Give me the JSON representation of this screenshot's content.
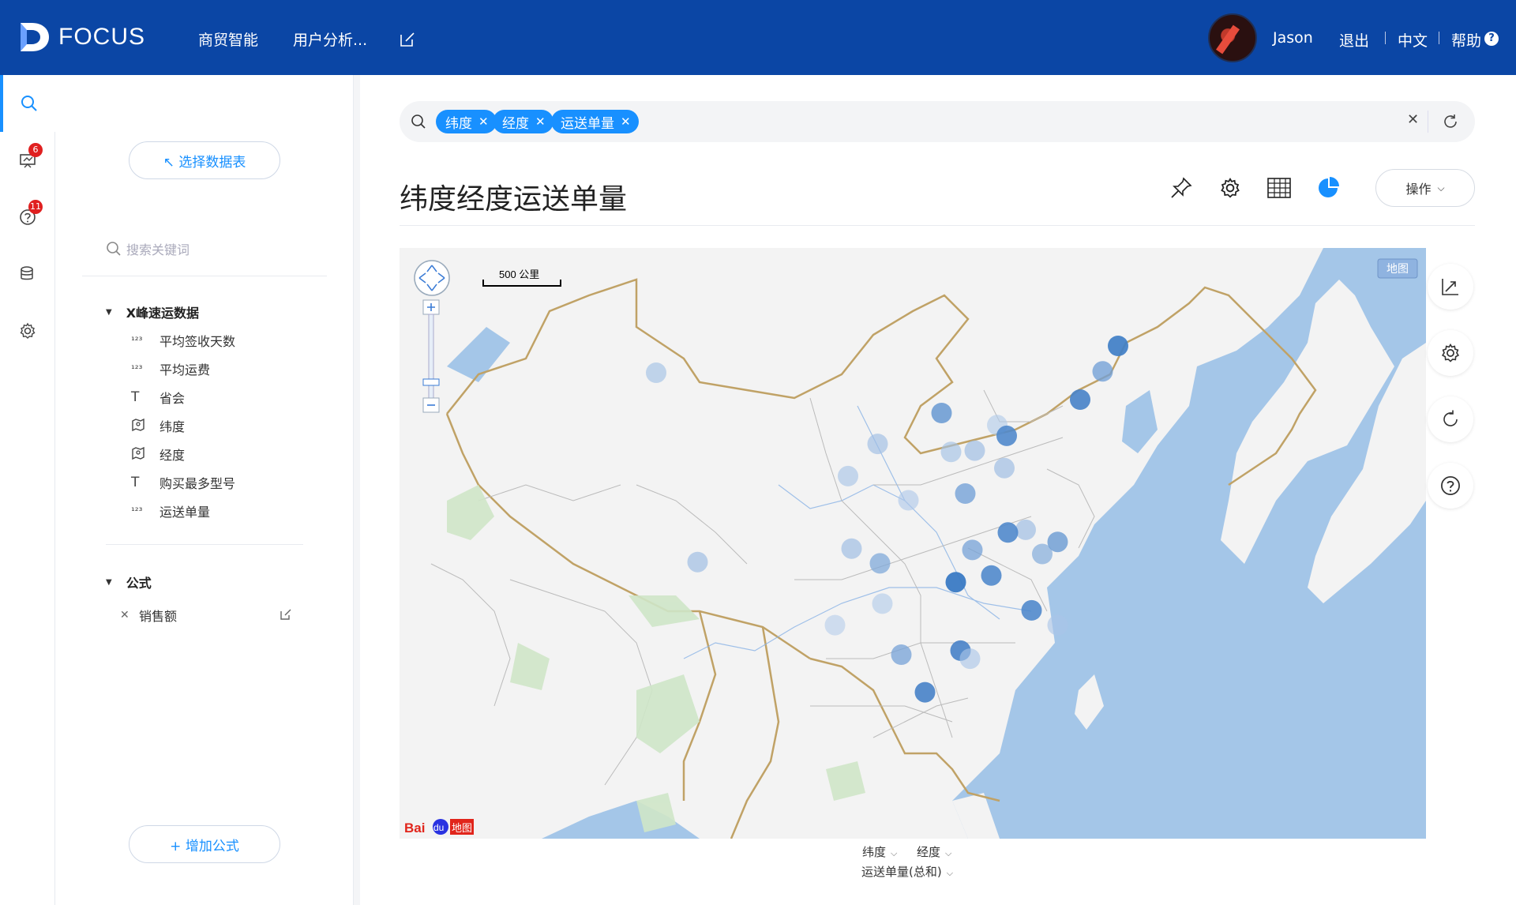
{
  "app": {
    "logo_text": "FOCUS",
    "brand_color": "#0b46a5",
    "accent_color": "#1890ff"
  },
  "nav": {
    "items": [
      {
        "label": "商贸智能"
      },
      {
        "label": "用户分析..."
      }
    ]
  },
  "user": {
    "name": "Jason",
    "logout": "退出",
    "lang": "中文",
    "help": "帮助",
    "help_badge": "?"
  },
  "iconbar": {
    "items": [
      {
        "icon": "search-icon"
      },
      {
        "icon": "board-icon",
        "badge": "6"
      },
      {
        "icon": "question-icon",
        "badge": "11"
      },
      {
        "icon": "database-icon"
      },
      {
        "icon": "gear-icon"
      }
    ]
  },
  "sidebar": {
    "select_table": "↖ 选择数据表",
    "search_placeholder": "搜索关键词",
    "source": {
      "name": "X峰速运数据",
      "fields": [
        {
          "icon": "123",
          "label": "平均签收天数"
        },
        {
          "icon": "123",
          "label": "平均运费"
        },
        {
          "icon": "T",
          "label": "省会"
        },
        {
          "icon": "geo",
          "label": "纬度"
        },
        {
          "icon": "geo",
          "label": "经度"
        },
        {
          "icon": "T",
          "label": "购买最多型号"
        },
        {
          "icon": "123",
          "label": "运送单量"
        }
      ]
    },
    "formula": {
      "name": "公式",
      "items": [
        {
          "label": "销售额"
        }
      ]
    },
    "add_formula": "+ 增加公式"
  },
  "query": {
    "tags": [
      {
        "label": "纬度"
      },
      {
        "label": "经度"
      },
      {
        "label": "运送单量"
      }
    ]
  },
  "chart": {
    "title": "纬度经度运送单量",
    "operate_label": "操作",
    "map_label": "地图",
    "scale_label": "500 公里",
    "axis_lat": "纬度",
    "axis_lon": "经度",
    "axis_value": "运送单量(总和)"
  },
  "chart_data": {
    "type": "scatter",
    "x_label": "经度",
    "y_label": "纬度",
    "value_label": "运送单量(总和)",
    "points": [
      {
        "lon": 126.6,
        "lat": 45.8,
        "level": 0.95
      },
      {
        "lon": 125.3,
        "lat": 43.9,
        "level": 0.6
      },
      {
        "lon": 123.4,
        "lat": 41.8,
        "level": 0.9
      },
      {
        "lon": 87.6,
        "lat": 43.8,
        "level": 0.25
      },
      {
        "lon": 116.4,
        "lat": 39.9,
        "level": 0.15
      },
      {
        "lon": 117.2,
        "lat": 39.1,
        "level": 0.85
      },
      {
        "lon": 117.0,
        "lat": 36.7,
        "level": 0.3
      },
      {
        "lon": 114.5,
        "lat": 38.0,
        "level": 0.3
      },
      {
        "lon": 112.5,
        "lat": 37.9,
        "level": 0.25
      },
      {
        "lon": 111.7,
        "lat": 40.8,
        "level": 0.7
      },
      {
        "lon": 106.3,
        "lat": 38.5,
        "level": 0.28
      },
      {
        "lon": 103.8,
        "lat": 36.1,
        "level": 0.22
      },
      {
        "lon": 118.8,
        "lat": 32.1,
        "level": 0.3
      },
      {
        "lon": 113.7,
        "lat": 34.8,
        "level": 0.6
      },
      {
        "lon": 108.9,
        "lat": 34.3,
        "level": 0.18
      },
      {
        "lon": 120.2,
        "lat": 30.3,
        "level": 0.45
      },
      {
        "lon": 117.3,
        "lat": 31.9,
        "level": 0.85
      },
      {
        "lon": 121.5,
        "lat": 31.2,
        "level": 0.65
      },
      {
        "lon": 104.1,
        "lat": 30.7,
        "level": 0.3
      },
      {
        "lon": 106.5,
        "lat": 29.6,
        "level": 0.5
      },
      {
        "lon": 114.3,
        "lat": 30.6,
        "level": 0.55
      },
      {
        "lon": 115.9,
        "lat": 28.7,
        "level": 0.85
      },
      {
        "lon": 112.9,
        "lat": 28.2,
        "level": 1.0
      },
      {
        "lon": 119.3,
        "lat": 26.1,
        "level": 0.85
      },
      {
        "lon": 121.5,
        "lat": 25.0,
        "level": 0.2
      },
      {
        "lon": 91.1,
        "lat": 29.7,
        "level": 0.3
      },
      {
        "lon": 106.7,
        "lat": 26.6,
        "level": 0.15
      },
      {
        "lon": 102.7,
        "lat": 25.0,
        "level": 0.12
      },
      {
        "lon": 113.3,
        "lat": 23.1,
        "level": 0.9
      },
      {
        "lon": 114.1,
        "lat": 22.5,
        "level": 0.2
      },
      {
        "lon": 108.3,
        "lat": 22.8,
        "level": 0.55
      },
      {
        "lon": 110.3,
        "lat": 20.0,
        "level": 0.9
      }
    ]
  }
}
